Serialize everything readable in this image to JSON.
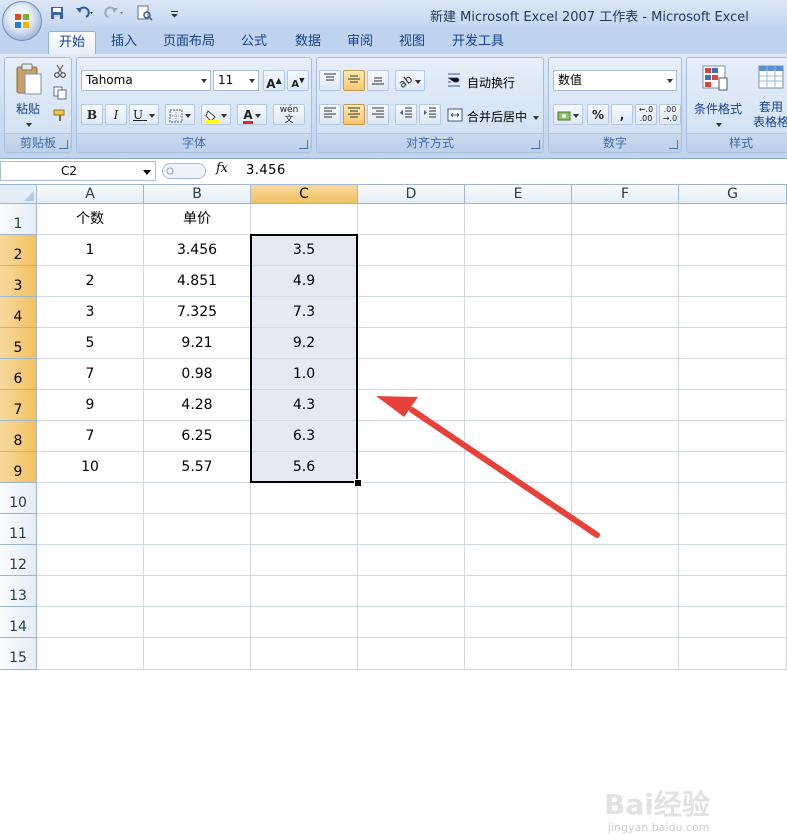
{
  "window": {
    "title": "新建 Microsoft Excel 2007 工作表 - Microsoft Excel"
  },
  "tabs": [
    "开始",
    "插入",
    "页面布局",
    "公式",
    "数据",
    "审阅",
    "视图",
    "开发工具"
  ],
  "ribbon": {
    "clipboard": {
      "paste": "粘贴",
      "label": "剪贴板"
    },
    "font": {
      "name": "Tahoma",
      "size": "11",
      "label": "字体"
    },
    "alignment": {
      "wrap": "自动换行",
      "merge": "合并后居中",
      "label": "对齐方式"
    },
    "number": {
      "format": "数值",
      "label": "数字",
      "percent": "%",
      "comma": ","
    },
    "styles": {
      "conditional": "条件格式",
      "table_line1": "套用",
      "table_line2": "表格格",
      "label": "样式"
    }
  },
  "formula_bar": {
    "name_box": "C2",
    "fx": "fx",
    "value": "3.456"
  },
  "columns": [
    "A",
    "B",
    "C",
    "D",
    "E",
    "F",
    "G"
  ],
  "rows": [
    "1",
    "2",
    "3",
    "4",
    "5",
    "6",
    "7",
    "8",
    "9",
    "10",
    "11",
    "12",
    "13",
    "14",
    "15"
  ],
  "cells": {
    "A1": "个数",
    "B1": "单价",
    "A2": "1",
    "B2": "3.456",
    "C2": "3.5",
    "A3": "2",
    "B3": "4.851",
    "C3": "4.9",
    "A4": "3",
    "B4": "7.325",
    "C4": "7.3",
    "A5": "5",
    "B5": "9.21",
    "C5": "9.2",
    "A6": "7",
    "B6": "0.98",
    "C6": "1.0",
    "A7": "9",
    "B7": "4.28",
    "C7": "4.3",
    "A8": "7",
    "B8": "6.25",
    "C8": "6.3",
    "A9": "10",
    "B9": "5.57",
    "C9": "5.6"
  },
  "selection": {
    "range": "C2:C9",
    "active": "C2",
    "highlight_column": "C"
  },
  "annotation": {
    "arrow_color": "#e8413a"
  },
  "watermark": {
    "brand": "Bai经验",
    "url": "jingyan.baidu.com"
  }
}
